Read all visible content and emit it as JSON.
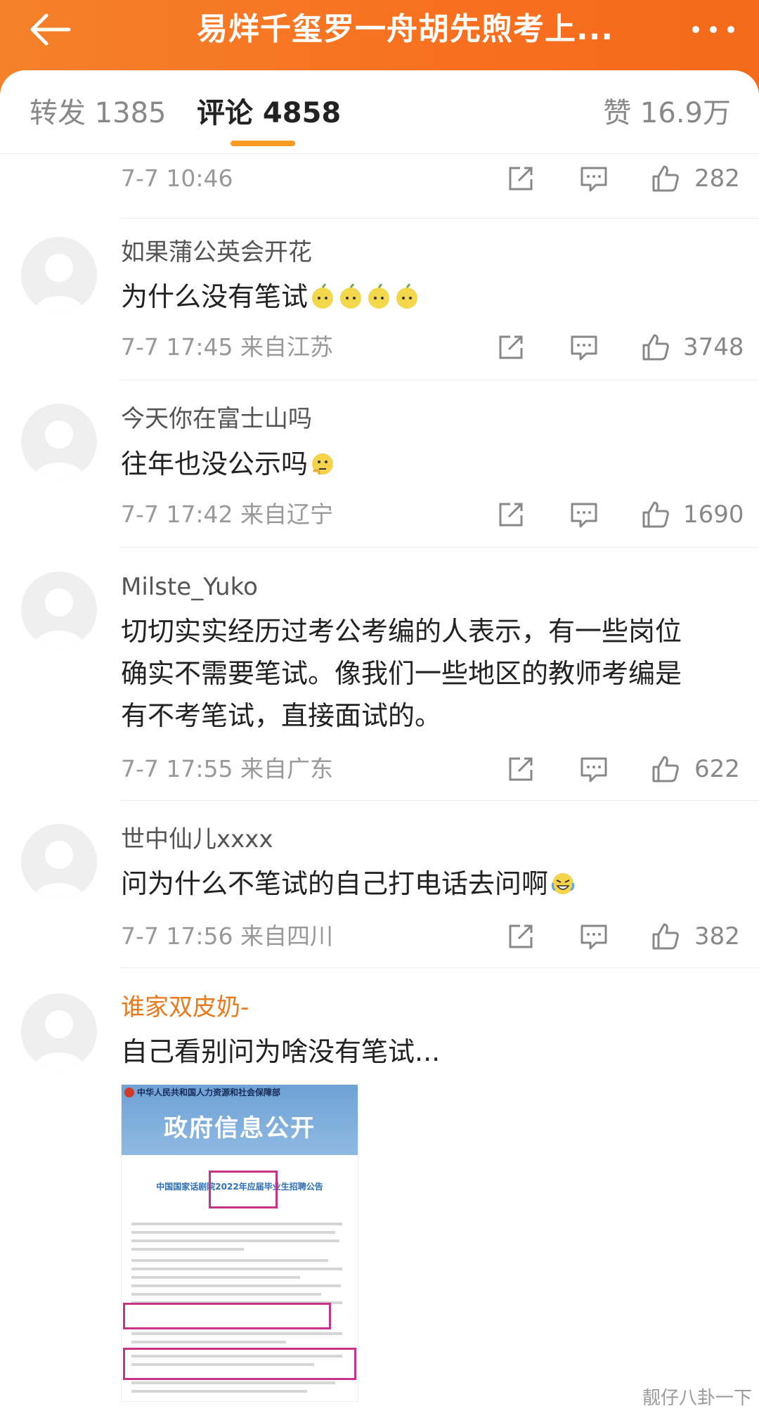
{
  "header": {
    "title": "易烊千玺罗一舟胡先煦考上...",
    "back_icon": "arrow-left-icon",
    "more_icon": "more-dots-icon"
  },
  "tabs": {
    "forward": "转发 1385",
    "comments": "评论 4858",
    "likes": "赞 16.9万"
  },
  "first_meta": {
    "time": "7-7 10:46",
    "likes": "282"
  },
  "comments": [
    {
      "user": "如果蒲公英会开花",
      "text": "为什么没有笔试",
      "emoji": "pear-emoji ×4",
      "time": "7-7 17:45 来自江苏",
      "likes": "3748"
    },
    {
      "user": "今天你在富士山吗",
      "text": "往年也没公示吗",
      "emoji": "thinking-emoji",
      "time": "7-7 17:42 来自辽宁",
      "likes": "1690"
    },
    {
      "user": "Milste_Yuko",
      "lines": [
        "切切实实经历过考公考编的人表示，有一些岗位",
        "确实不需要笔试。像我们一些地区的教师考编是",
        "有不考笔试，直接面试的。"
      ],
      "time": "7-7 17:55 来自广东",
      "likes": "622"
    },
    {
      "user": "世中仙儿xxxx",
      "text": "问为什么不笔试的自己打电话去问啊",
      "emoji": "laugh-cry-emoji",
      "time": "7-7 17:56 来自四川",
      "likes": "382"
    },
    {
      "user": "谁家双皮奶-",
      "text": "自己看别问为啥没有笔试..."
    }
  ],
  "image": {
    "org": "中华人民共和国人力资源和社会保障部",
    "banner": "政府信息公开",
    "title": "中国国家话剧院2022年应届毕业生招聘公告"
  },
  "watermark": "靓仔八卦一下",
  "colors": {
    "header": "#f7701f",
    "accent": "#f79b22",
    "highlight": "#c8338a",
    "orange_name": "#ea7a1b"
  }
}
